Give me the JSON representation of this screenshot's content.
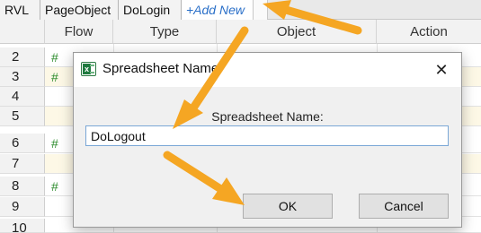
{
  "tabs": [
    {
      "label": "RVL"
    },
    {
      "label": "PageObject"
    },
    {
      "label": "DoLogin"
    },
    {
      "label": "+Add New"
    }
  ],
  "grid": {
    "headers": {
      "flow": "Flow",
      "type": "Type",
      "object": "Object",
      "action": "Action"
    },
    "row_numbers": [
      "2",
      "3",
      "4",
      "5",
      "6",
      "7",
      "8",
      "9",
      "10"
    ],
    "hash_mark": "#"
  },
  "dialog": {
    "title": "Spreadsheet Name",
    "close_glyph": "✕",
    "field_label": "Spreadsheet Name:",
    "field_value": "DoLogout",
    "ok_label": "OK",
    "cancel_label": "Cancel"
  },
  "colors": {
    "annotation_arrow": "#f5a623",
    "link_blue": "#2a6fc8",
    "hash_green": "#2a8a2a"
  }
}
